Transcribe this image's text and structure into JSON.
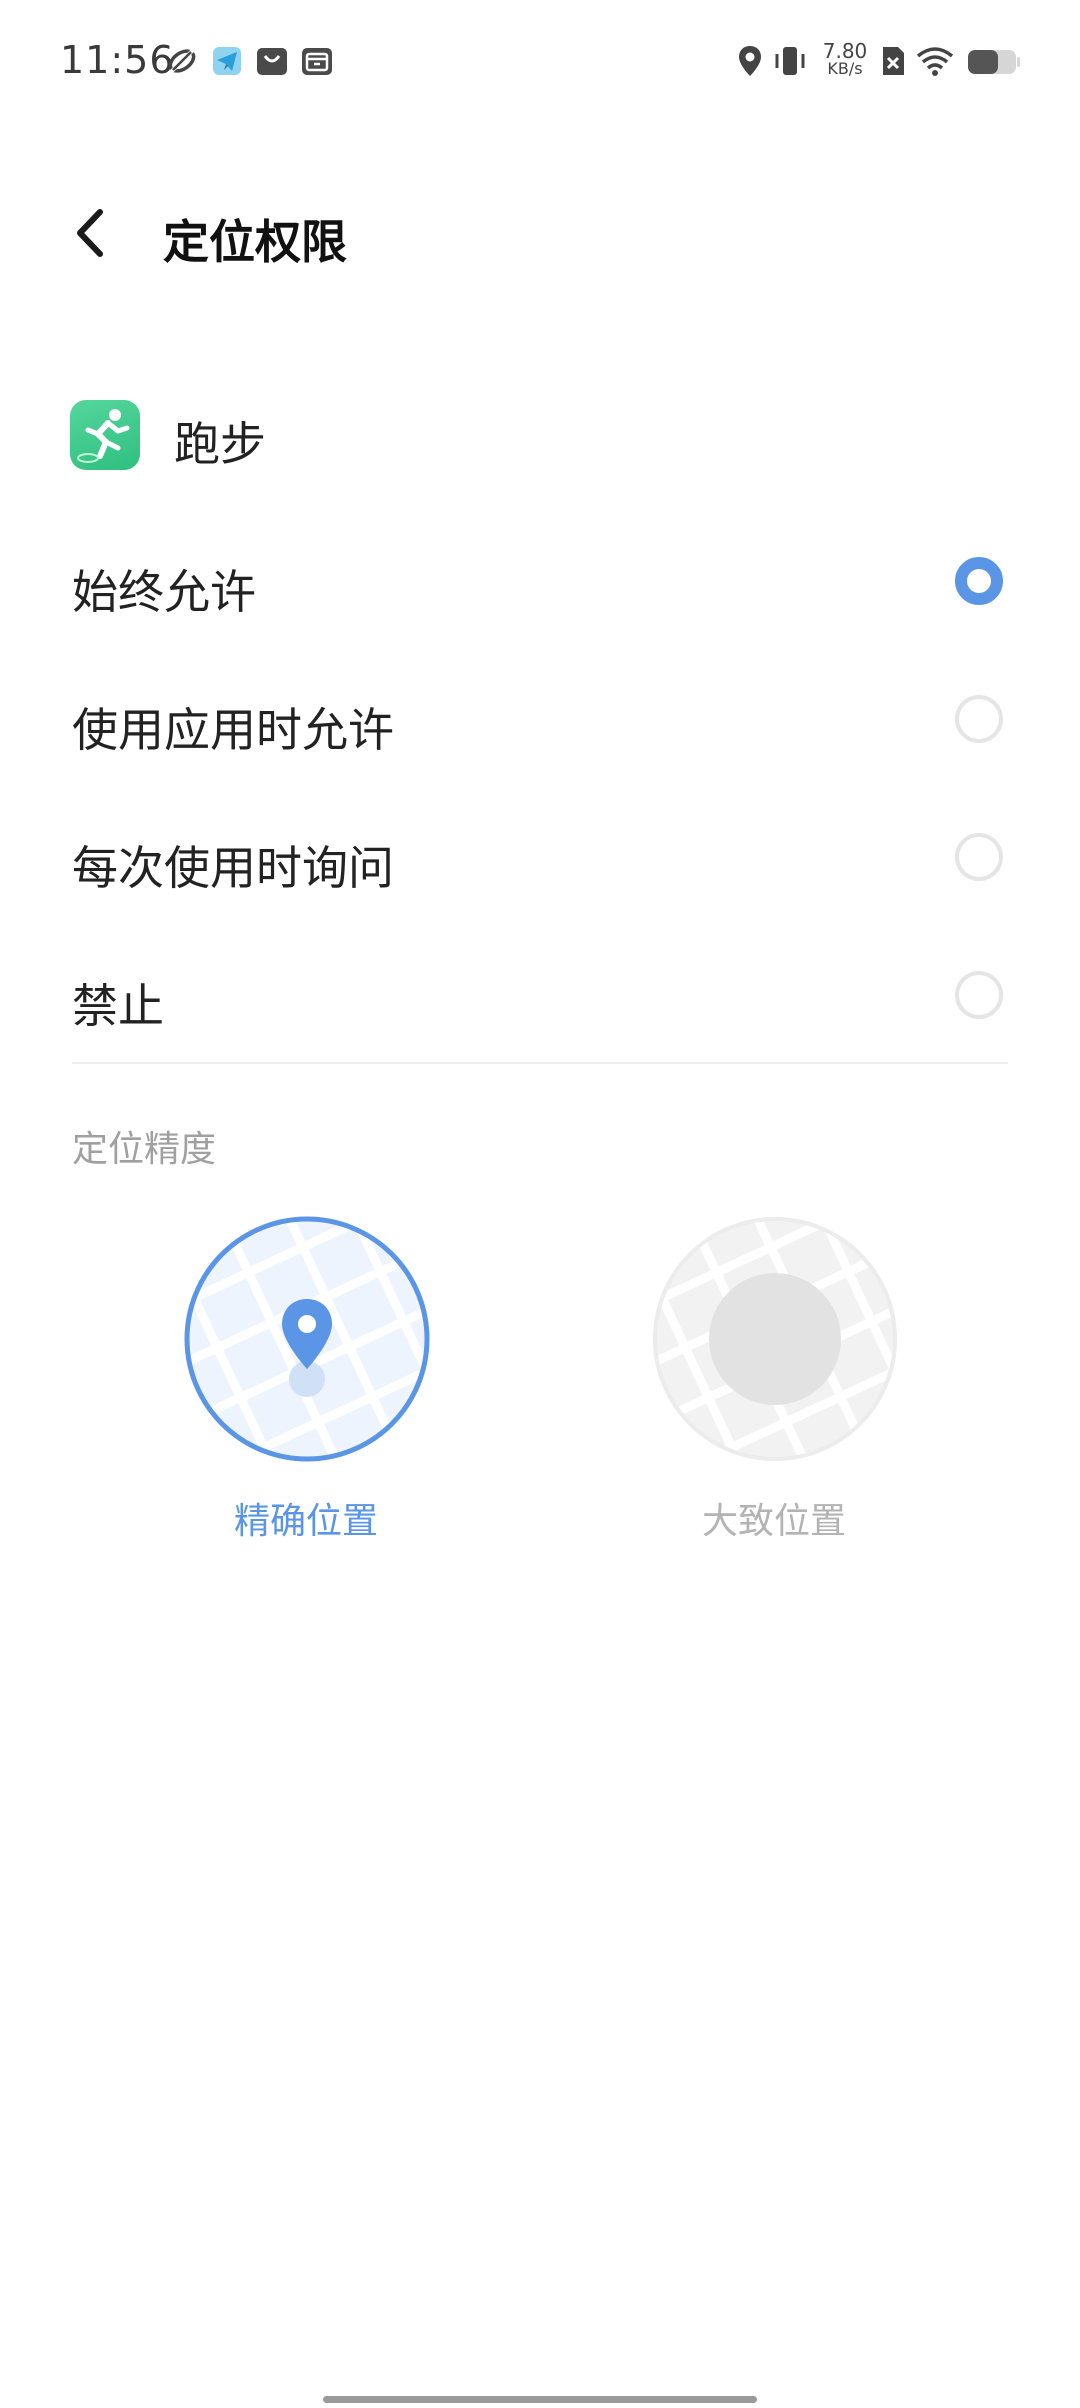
{
  "status_bar": {
    "time": "11:56",
    "net_speed_value": "7.80",
    "net_speed_unit": "KB/s",
    "icons": [
      "sync-icon",
      "telegram-icon",
      "bag-icon",
      "archive-icon",
      "location-icon",
      "vibrate-icon",
      "no-sim-icon",
      "wifi-icon",
      "battery-icon"
    ]
  },
  "header": {
    "title": "定位权限"
  },
  "app": {
    "name": "跑步",
    "icon": "running-app-icon"
  },
  "options": [
    {
      "label": "始终允许",
      "selected": true
    },
    {
      "label": "使用应用时允许",
      "selected": false
    },
    {
      "label": "每次使用时询问",
      "selected": false
    },
    {
      "label": "禁止",
      "selected": false
    }
  ],
  "precision": {
    "section_label": "定位精度",
    "precise_label": "精确位置",
    "approximate_label": "大致位置",
    "selected": "precise"
  },
  "colors": {
    "accent": "#5b95e6",
    "app_green": "#3cc98a",
    "muted": "#a0a0a0"
  }
}
